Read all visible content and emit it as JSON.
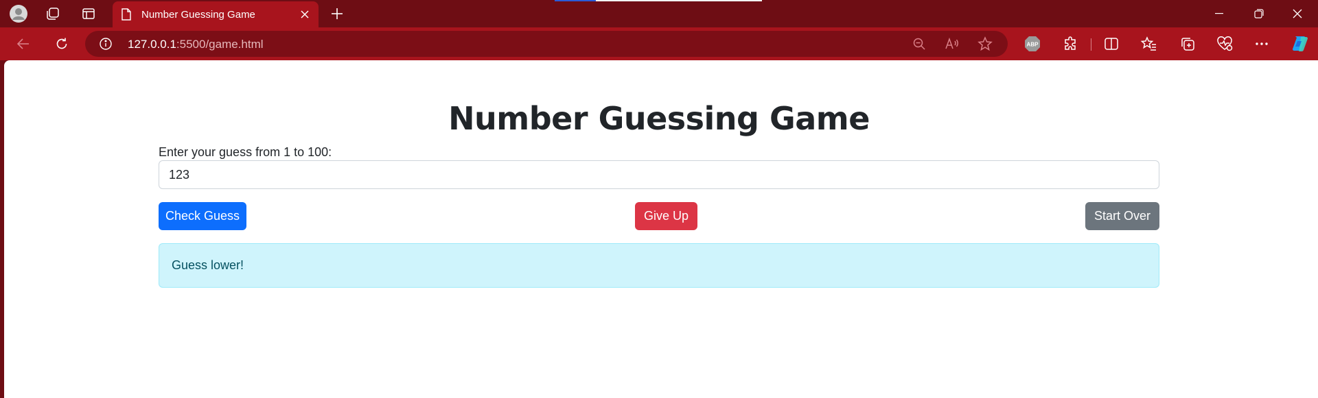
{
  "browser": {
    "tab": {
      "title": "Number Guessing Game"
    },
    "url": {
      "host": "127.0.0.1",
      "path": ":5500/game.html"
    },
    "colors": {
      "frame": "#6e0d14",
      "toolbar": "#a8141d",
      "addressbar": "#7c0e16"
    },
    "icons": [
      "profile-icon",
      "workspaces-icon",
      "tab-actions-icon",
      "page-icon",
      "close-icon",
      "new-tab-icon",
      "minimize-icon",
      "restore-icon",
      "window-close-icon",
      "back-icon",
      "refresh-icon",
      "info-icon",
      "zoom-out-icon",
      "read-aloud-icon",
      "favorite-icon",
      "adblock-icon",
      "extensions-icon",
      "split-screen-icon",
      "favorites-icon",
      "collections-icon",
      "browser-essentials-icon",
      "more-icon",
      "copilot-icon"
    ],
    "adblock_label": "ABP"
  },
  "page": {
    "heading": "Number Guessing Game",
    "input_label": "Enter your guess from 1 to 100:",
    "guess_value": "123",
    "buttons": {
      "check": "Check Guess",
      "give_up": "Give Up",
      "start_over": "Start Over"
    },
    "message": "Guess lower!",
    "colors": {
      "primary": "#0d6efd",
      "danger": "#dc3545",
      "secondary": "#6c757d",
      "info_bg": "#cff4fc",
      "info_text": "#055160"
    }
  }
}
